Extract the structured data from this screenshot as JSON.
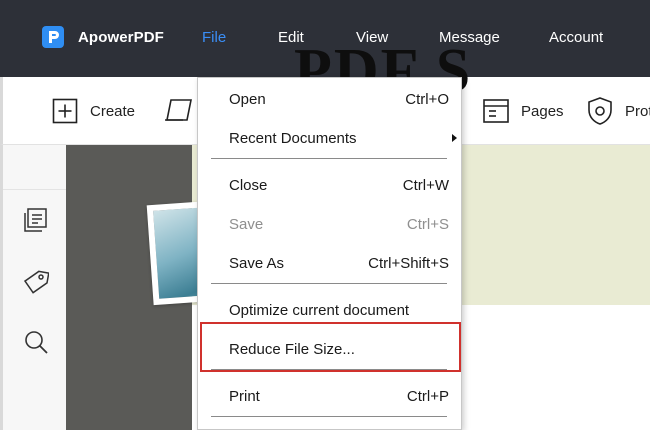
{
  "app": {
    "name": "ApowerPDF",
    "brand_color": "#2f8ef3"
  },
  "menubar": {
    "items": [
      {
        "label": "File",
        "active": true
      },
      {
        "label": "Edit"
      },
      {
        "label": "View"
      },
      {
        "label": "Message"
      },
      {
        "label": "Account"
      }
    ]
  },
  "toolbar": {
    "create_label": "Create",
    "pages_label": "Pages",
    "protect_label": "Prot"
  },
  "document": {
    "heading": "PDF S"
  },
  "file_menu": {
    "open": {
      "label": "Open",
      "shortcut": "Ctrl+O"
    },
    "recent": {
      "label": "Recent Documents"
    },
    "close": {
      "label": "Close",
      "shortcut": "Ctrl+W"
    },
    "save": {
      "label": "Save",
      "shortcut": "Ctrl+S",
      "disabled": true
    },
    "save_as": {
      "label": "Save As",
      "shortcut": "Ctrl+Shift+S"
    },
    "optimize": {
      "label": "Optimize current document"
    },
    "reduce": {
      "label": "Reduce File Size..."
    },
    "print": {
      "label": "Print",
      "shortcut": "Ctrl+P"
    }
  },
  "colors": {
    "titlebar": "#2d3038",
    "active_menu": "#3a8ef6",
    "highlight": "#d0312d"
  }
}
